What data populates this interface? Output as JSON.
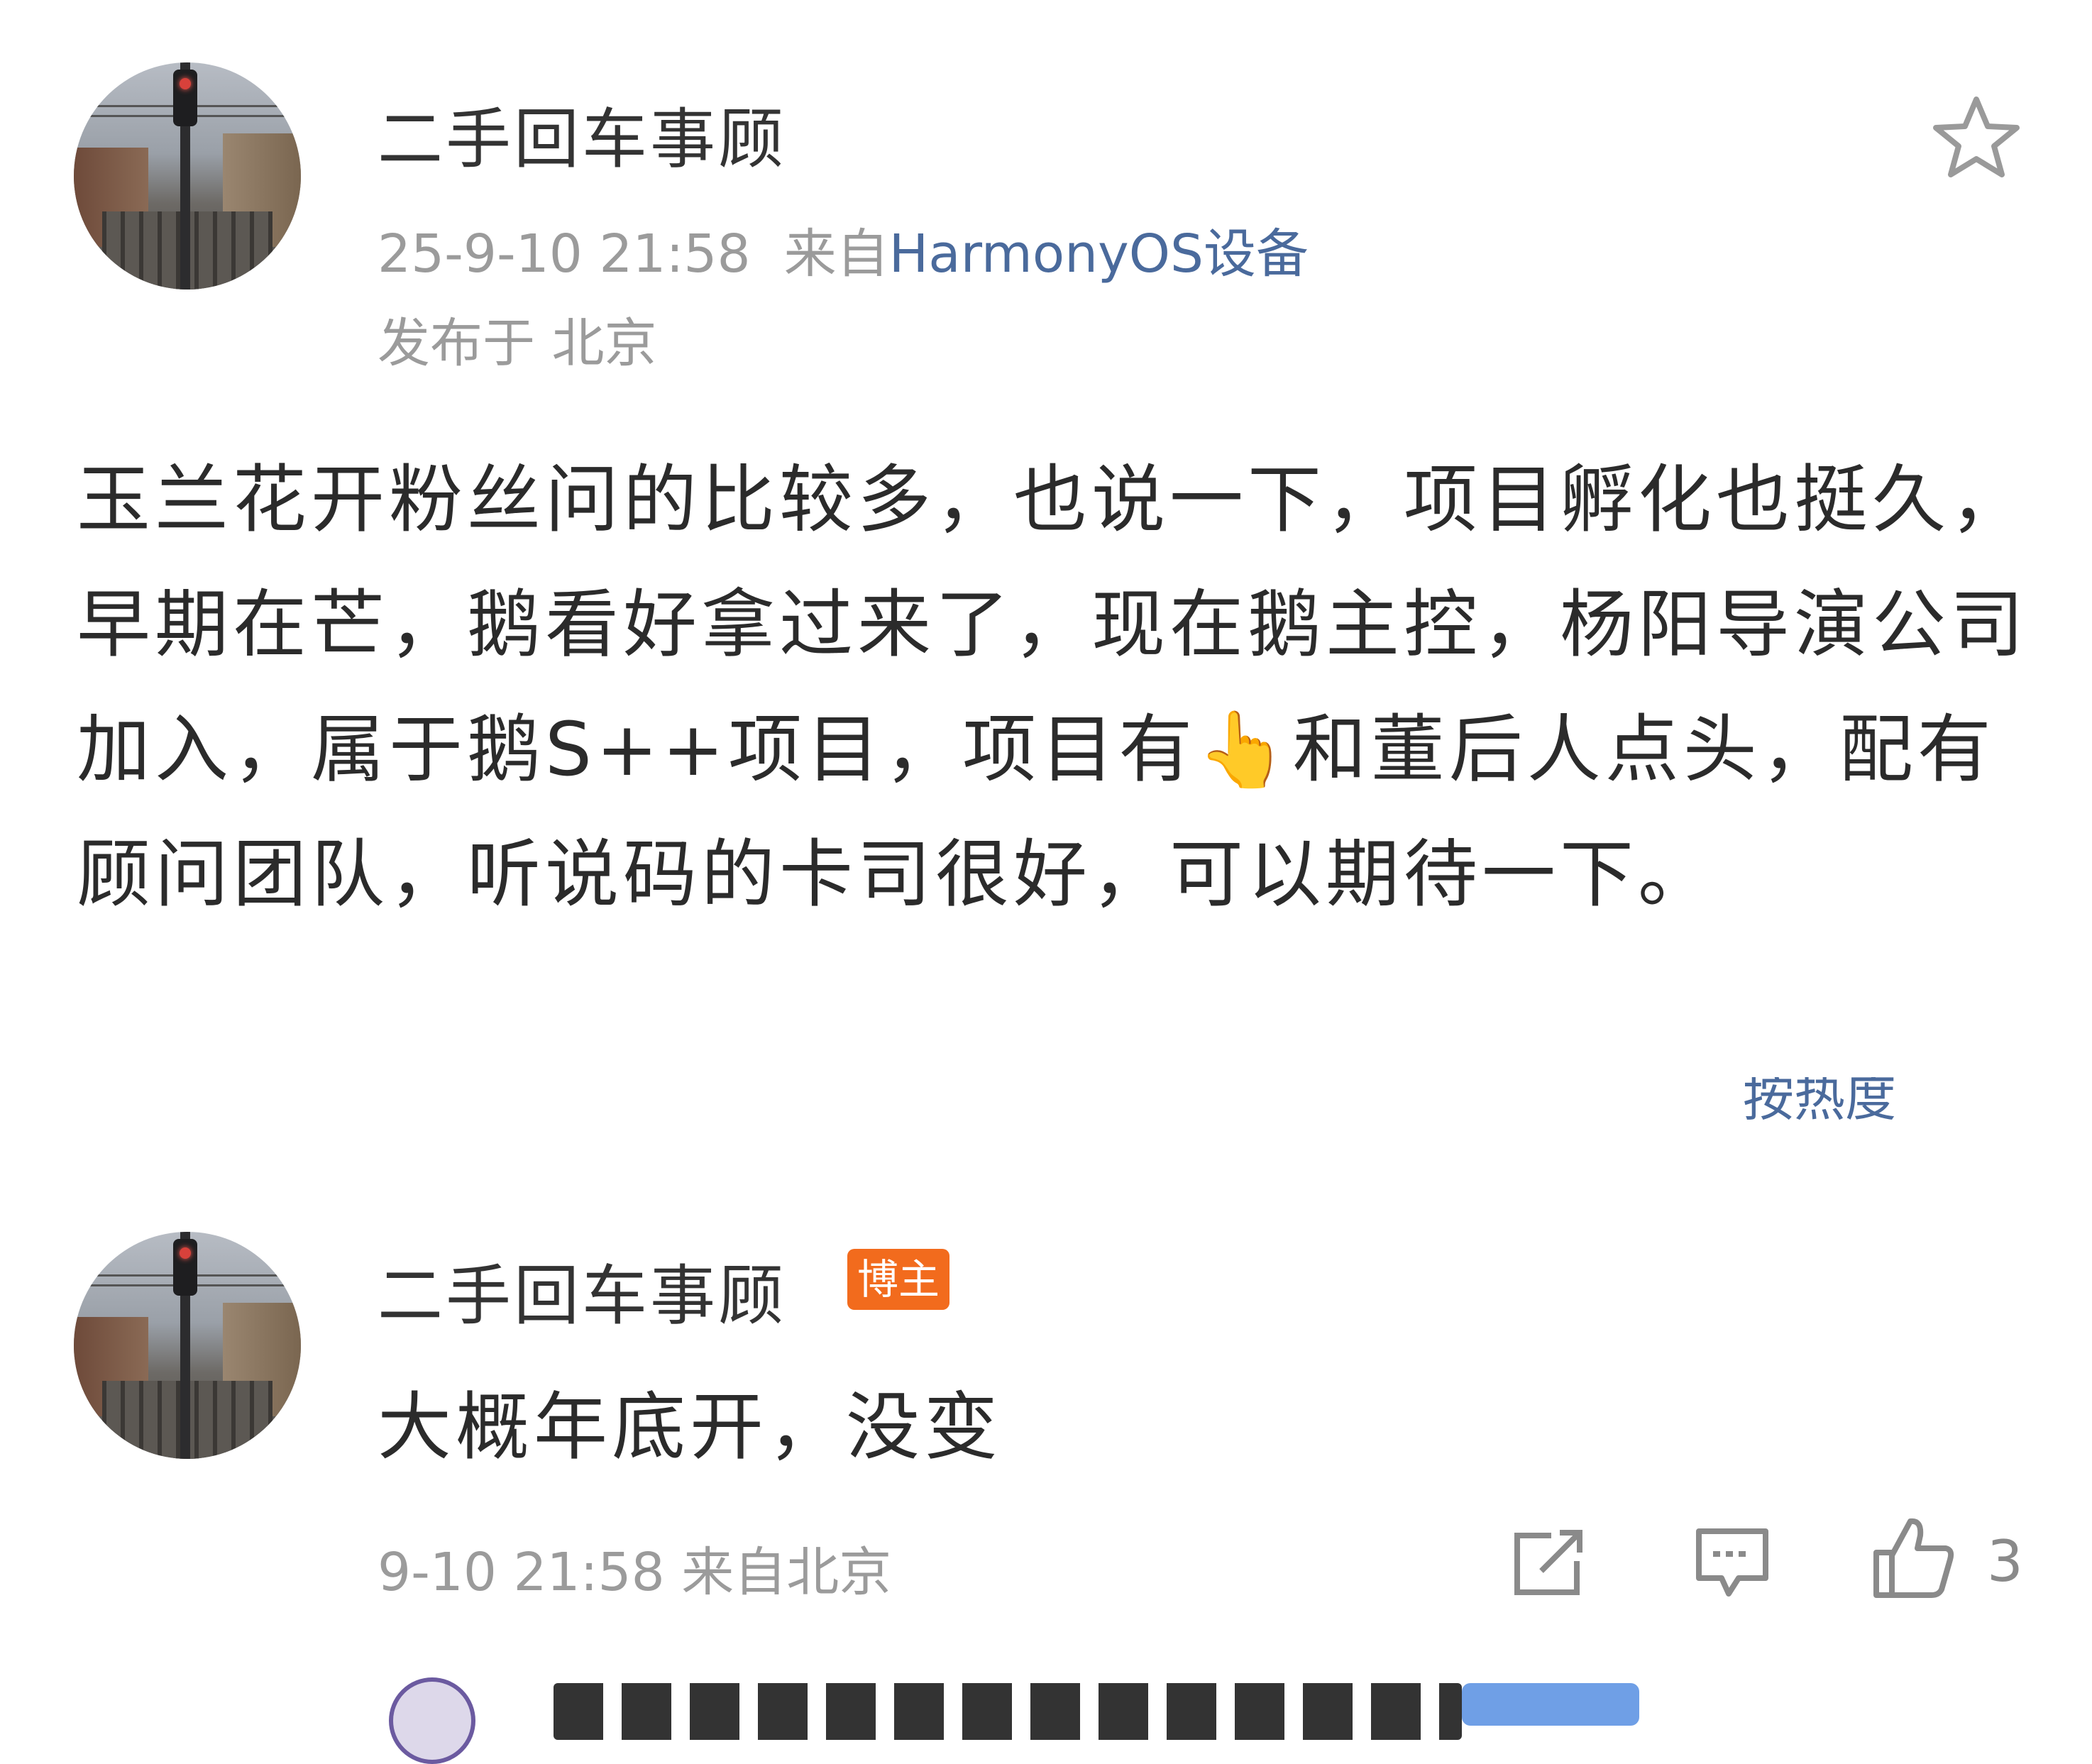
{
  "post": {
    "author": "二手回车事顾",
    "timestamp": "25-9-10 21:58",
    "source_prefix": "来自",
    "device": "HarmonyOS设备",
    "location": "发布于 北京",
    "body": "玉兰花开粉丝问的比较多，也说一下，项目孵化也挺久，早期在芒，鹅看好拿过来了，现在鹅主控，杨阳导演公司加入，属于鹅S++项目，项目有👆和董后人点头，配有顾问团队，听说码的卡司很好，可以期待一下。",
    "favorite_icon": "star-outline-icon"
  },
  "comments_header": {
    "sort_label": "按热度"
  },
  "reply": {
    "author": "二手回车事顾",
    "badge": "博主",
    "text": "大概年底开，没变",
    "meta": "9-10 21:58 来自北京",
    "like_count": "3",
    "icons": [
      "share-icon",
      "comment-icon",
      "like-icon"
    ]
  },
  "colors": {
    "link": "#4a6a9c",
    "badge": "#f26b1d",
    "meta": "#9b9b9b"
  }
}
